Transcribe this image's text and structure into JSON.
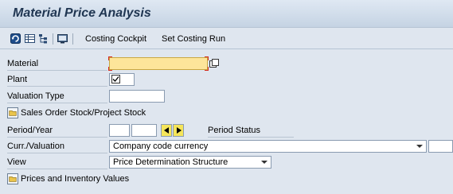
{
  "window": {
    "title": "Material Price Analysis"
  },
  "toolbar": {
    "icons": [
      "refresh-icon",
      "list-icon",
      "hierarchy-icon",
      "display-icon"
    ],
    "costing_cockpit_label": "Costing Cockpit",
    "set_costing_run_label": "Set Costing Run"
  },
  "form": {
    "material_label": "Material",
    "material_value": "",
    "plant_label": "Plant",
    "plant_value": "",
    "valuation_type_label": "Valuation Type",
    "valuation_type_value": "",
    "sales_order_button": "Sales Order Stock/Project Stock",
    "period_year_label": "Period/Year",
    "period_value": "",
    "year_value": "",
    "period_status_label": "Period Status",
    "curr_valuation_label": "Curr./Valuation",
    "curr_valuation_value": "Company code currency",
    "view_label": "View",
    "view_value": "Price Determination Structure",
    "prices_inventory_button": "Prices and Inventory Values"
  },
  "colors": {
    "background": "#dfe6ef",
    "title_text": "#1f3551",
    "required_field": "#fde59a",
    "nav_button": "#f5e55a"
  }
}
